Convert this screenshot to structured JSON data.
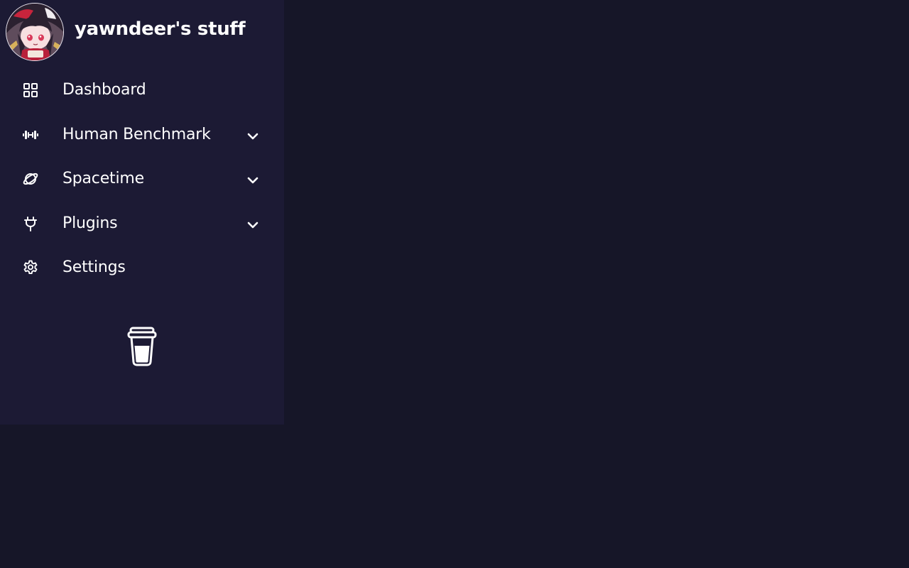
{
  "brand": {
    "title": "yawndeer's stuff"
  },
  "nav": {
    "items": [
      {
        "label": "Dashboard",
        "icon": "grid-icon",
        "expandable": false
      },
      {
        "label": "Human Benchmark",
        "icon": "dumbbell-icon",
        "expandable": true
      },
      {
        "label": "Spacetime",
        "icon": "planet-icon",
        "expandable": true
      },
      {
        "label": "Plugins",
        "icon": "plug-icon",
        "expandable": true
      },
      {
        "label": "Settings",
        "icon": "gear-icon",
        "expandable": false
      }
    ]
  },
  "footer": {
    "icon": "coffee-cup-icon"
  },
  "colors": {
    "background": "#161628",
    "sidebar": "#1c1a34",
    "text": "#ffffff"
  }
}
